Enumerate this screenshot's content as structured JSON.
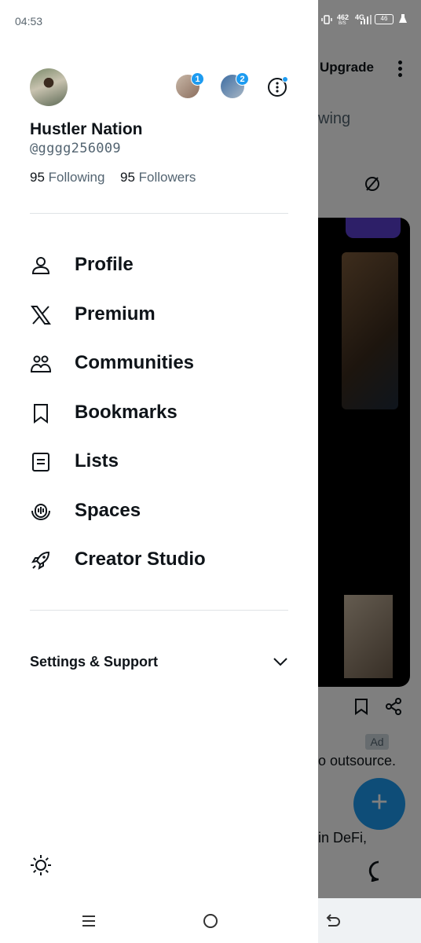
{
  "status_bar": {
    "time": "04:53",
    "net_speed": "462",
    "net_unit": "B/S",
    "network": "4G",
    "battery": "46"
  },
  "background": {
    "upgrade_label": "Upgrade",
    "tab_fragment": "wing",
    "ad_badge": "Ad",
    "text_fragment_1": "o outsource.",
    "text_fragment_2": "in DeFi,",
    "fab_label": "+"
  },
  "drawer": {
    "profile": {
      "display_name": "Hustler Nation",
      "handle": "@gggg256009",
      "following_count": "95",
      "following_label": "Following",
      "followers_count": "95",
      "followers_label": "Followers"
    },
    "accounts": [
      {
        "badge": "1"
      },
      {
        "badge": "2"
      }
    ],
    "menu": [
      {
        "label": "Profile",
        "icon": "person-icon"
      },
      {
        "label": "Premium",
        "icon": "x-logo-icon"
      },
      {
        "label": "Communities",
        "icon": "communities-icon"
      },
      {
        "label": "Bookmarks",
        "icon": "bookmark-icon"
      },
      {
        "label": "Lists",
        "icon": "lists-icon"
      },
      {
        "label": "Spaces",
        "icon": "spaces-icon"
      },
      {
        "label": "Creator Studio",
        "icon": "rocket-icon"
      }
    ],
    "settings_label": "Settings & Support"
  },
  "colors": {
    "accent": "#1d9bf0",
    "text": "#0f1419",
    "secondary": "#536471"
  }
}
